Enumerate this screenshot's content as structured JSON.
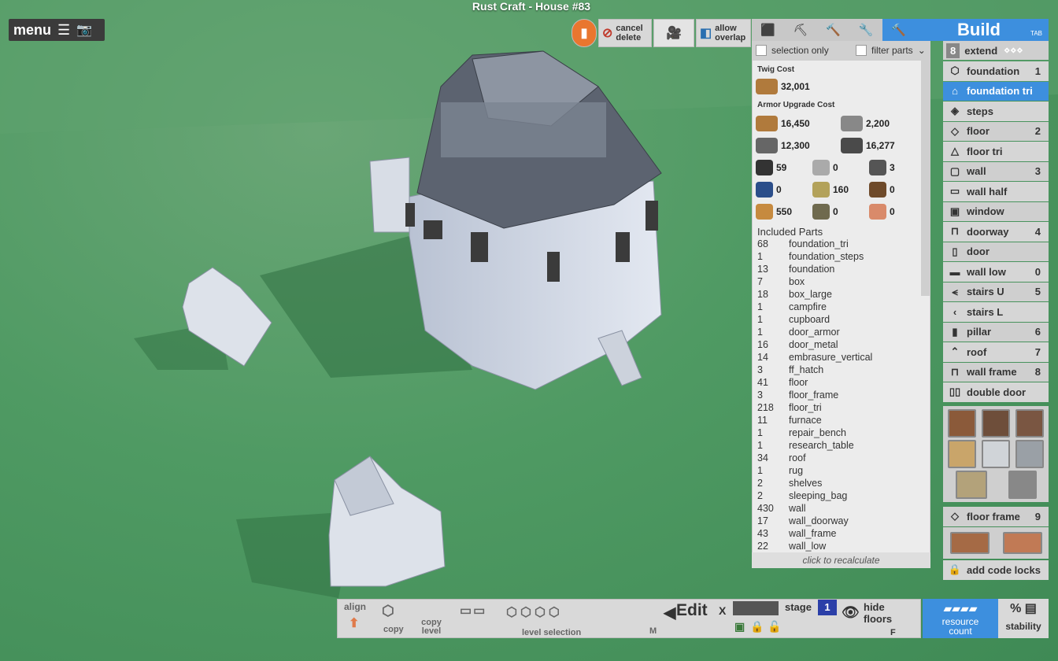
{
  "title": "Rust Craft - House #83",
  "menu": {
    "label": "menu"
  },
  "toolbar": {
    "cancel_delete": "cancel delete",
    "allow_overlap": "allow overlap"
  },
  "build": {
    "title": "Build",
    "tab_hint": "TAB"
  },
  "filters": {
    "selection_only": "selection only",
    "filter_parts": "filter parts"
  },
  "extend": {
    "count": "8",
    "label": "extend"
  },
  "cost": {
    "twig_header": "Twig Cost",
    "twig": "32,001",
    "armor_header": "Armor Upgrade Cost",
    "armor": [
      [
        "16,450",
        "2,200"
      ],
      [
        "12,300",
        "16,277"
      ],
      [
        "59",
        "0",
        "3"
      ],
      [
        "0",
        "160",
        "0"
      ],
      [
        "550",
        "0",
        "0"
      ]
    ]
  },
  "included_parts": {
    "header": "Included Parts",
    "rows": [
      [
        "68",
        "foundation_tri"
      ],
      [
        "1",
        "foundation_steps"
      ],
      [
        "13",
        "foundation"
      ],
      [
        "7",
        "box"
      ],
      [
        "18",
        "box_large"
      ],
      [
        "1",
        "campfire"
      ],
      [
        "1",
        "cupboard"
      ],
      [
        "1",
        "door_armor"
      ],
      [
        "16",
        "door_metal"
      ],
      [
        "14",
        "embrasure_vertical"
      ],
      [
        "3",
        "ff_hatch"
      ],
      [
        "41",
        "floor"
      ],
      [
        "3",
        "floor_frame"
      ],
      [
        "218",
        "floor_tri"
      ],
      [
        "11",
        "furnace"
      ],
      [
        "1",
        "repair_bench"
      ],
      [
        "1",
        "research_table"
      ],
      [
        "34",
        "roof"
      ],
      [
        "1",
        "rug"
      ],
      [
        "2",
        "shelves"
      ],
      [
        "2",
        "sleeping_bag"
      ],
      [
        "430",
        "wall"
      ],
      [
        "17",
        "wall_doorway"
      ],
      [
        "43",
        "wall_frame"
      ],
      [
        "22",
        "wall_low"
      ]
    ],
    "recalc": "click to recalculate"
  },
  "side": [
    {
      "label": "foundation",
      "num": "1",
      "icon": "cube-icon"
    },
    {
      "label": "foundation tri",
      "num": "",
      "icon": "triangle-icon",
      "selected": true
    },
    {
      "label": "steps",
      "num": "",
      "icon": "steps-icon"
    },
    {
      "label": "floor",
      "num": "2",
      "icon": "floor-icon"
    },
    {
      "label": "floor tri",
      "num": "",
      "icon": "floor-tri-icon"
    },
    {
      "label": "wall",
      "num": "3",
      "icon": "wall-icon"
    },
    {
      "label": "wall half",
      "num": "",
      "icon": "wall-half-icon"
    },
    {
      "label": "window",
      "num": "",
      "icon": "window-icon"
    },
    {
      "label": "doorway",
      "num": "4",
      "icon": "doorway-icon"
    },
    {
      "label": "door",
      "num": "",
      "icon": "door-icon"
    },
    {
      "label": "wall low",
      "num": "0",
      "icon": "wall-low-icon"
    },
    {
      "label": "stairs U",
      "num": "5",
      "icon": "stairs-u-icon"
    },
    {
      "label": "stairs L",
      "num": "",
      "icon": "stairs-l-icon"
    },
    {
      "label": "pillar",
      "num": "6",
      "icon": "pillar-icon"
    },
    {
      "label": "roof",
      "num": "7",
      "icon": "roof-icon"
    },
    {
      "label": "wall frame",
      "num": "8",
      "icon": "wall-frame-icon"
    },
    {
      "label": "double door",
      "num": "",
      "icon": "double-door-icon"
    }
  ],
  "floor_frame": {
    "label": "floor frame",
    "num": "9"
  },
  "code_locks": "add code locks",
  "bottom": {
    "align": "align",
    "copy": "copy",
    "copy_level": "copy level",
    "level_selection": "level selection",
    "edit": "Edit",
    "x": "X",
    "stage": "stage",
    "stage_num": "1",
    "hide_floors": "hide floors",
    "m": "M",
    "f": "F"
  },
  "resource_count": "resource count",
  "stability": "stability",
  "colors": {
    "accent": "#3d8fde",
    "panel": "#ececec"
  }
}
